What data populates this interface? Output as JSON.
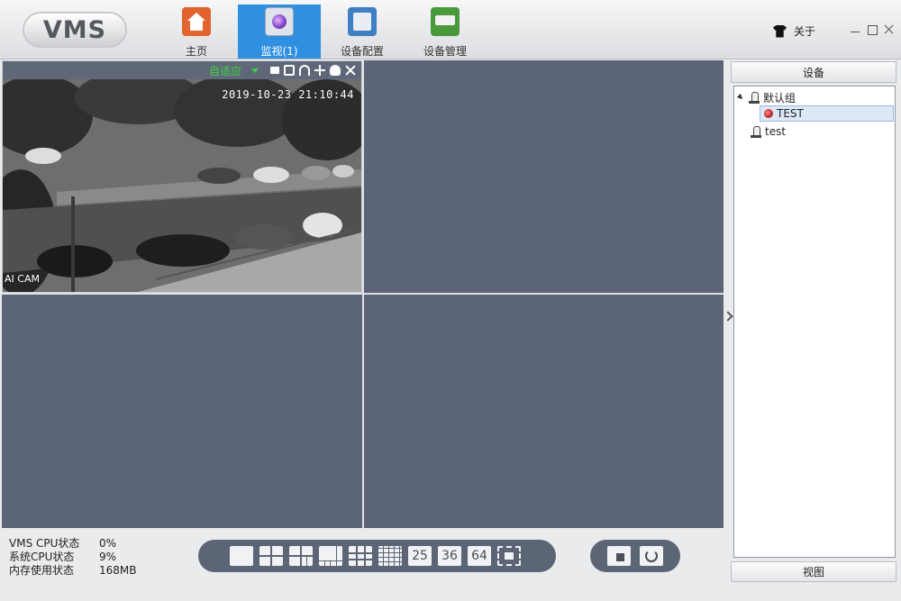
{
  "app": {
    "logo": "VMS"
  },
  "nav": {
    "tabs": [
      {
        "label": "主页",
        "icon": "home-icon"
      },
      {
        "label": "监视(1)",
        "icon": "monitor-icon",
        "active": true
      },
      {
        "label": "设备配置",
        "icon": "device-config-icon"
      },
      {
        "label": "设备管理",
        "icon": "device-manage-icon"
      }
    ]
  },
  "header": {
    "about_label": "关于"
  },
  "video": {
    "mode_label": "自适应",
    "timestamp": "2019-10-23 21:10:44",
    "camera_name": "AI CAM",
    "accent_color": "#3fd23f"
  },
  "right_panel": {
    "header": "设备",
    "footer": "视图",
    "tree": [
      {
        "label": "默认组",
        "type": "group",
        "expanded": true
      },
      {
        "label": "TEST",
        "type": "camera",
        "selected": true
      },
      {
        "label": "test",
        "type": "group"
      }
    ]
  },
  "status": {
    "rows": [
      {
        "key": "VMS CPU状态",
        "value": "0%"
      },
      {
        "key": "系统CPU状态",
        "value": "9%"
      },
      {
        "key": "内存使用状态",
        "value": "168MB"
      }
    ]
  },
  "toolbar": {
    "layout_counts": [
      "25",
      "36",
      "64"
    ]
  },
  "colors": {
    "active_tab": "#2f8fe0",
    "video_cell": "#5b6577"
  }
}
